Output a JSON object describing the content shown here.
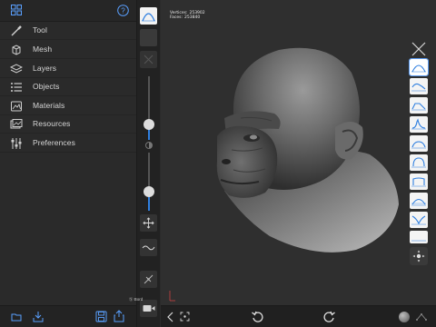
{
  "menu": {
    "items": [
      {
        "label": "Tool",
        "icon": "brush-icon"
      },
      {
        "label": "Mesh",
        "icon": "mesh-cube-icon"
      },
      {
        "label": "Layers",
        "icon": "layers-icon"
      },
      {
        "label": "Objects",
        "icon": "objects-list-icon"
      },
      {
        "label": "Materials",
        "icon": "materials-icon"
      },
      {
        "label": "Resources",
        "icon": "resources-icon"
      },
      {
        "label": "Preferences",
        "icon": "preferences-sliders-icon"
      }
    ]
  },
  "stats": {
    "vertices_label": "Vertices:",
    "vertices_value": "253902",
    "faces_label": "Faces:",
    "faces_value": "253840"
  },
  "viewport": {
    "subdivision_label": "Ⓢ Bord"
  },
  "colors": {
    "accent": "#2f7fe0",
    "panel_bg": "#2a2a2a",
    "viewport_bg": "#2f2f2f"
  }
}
